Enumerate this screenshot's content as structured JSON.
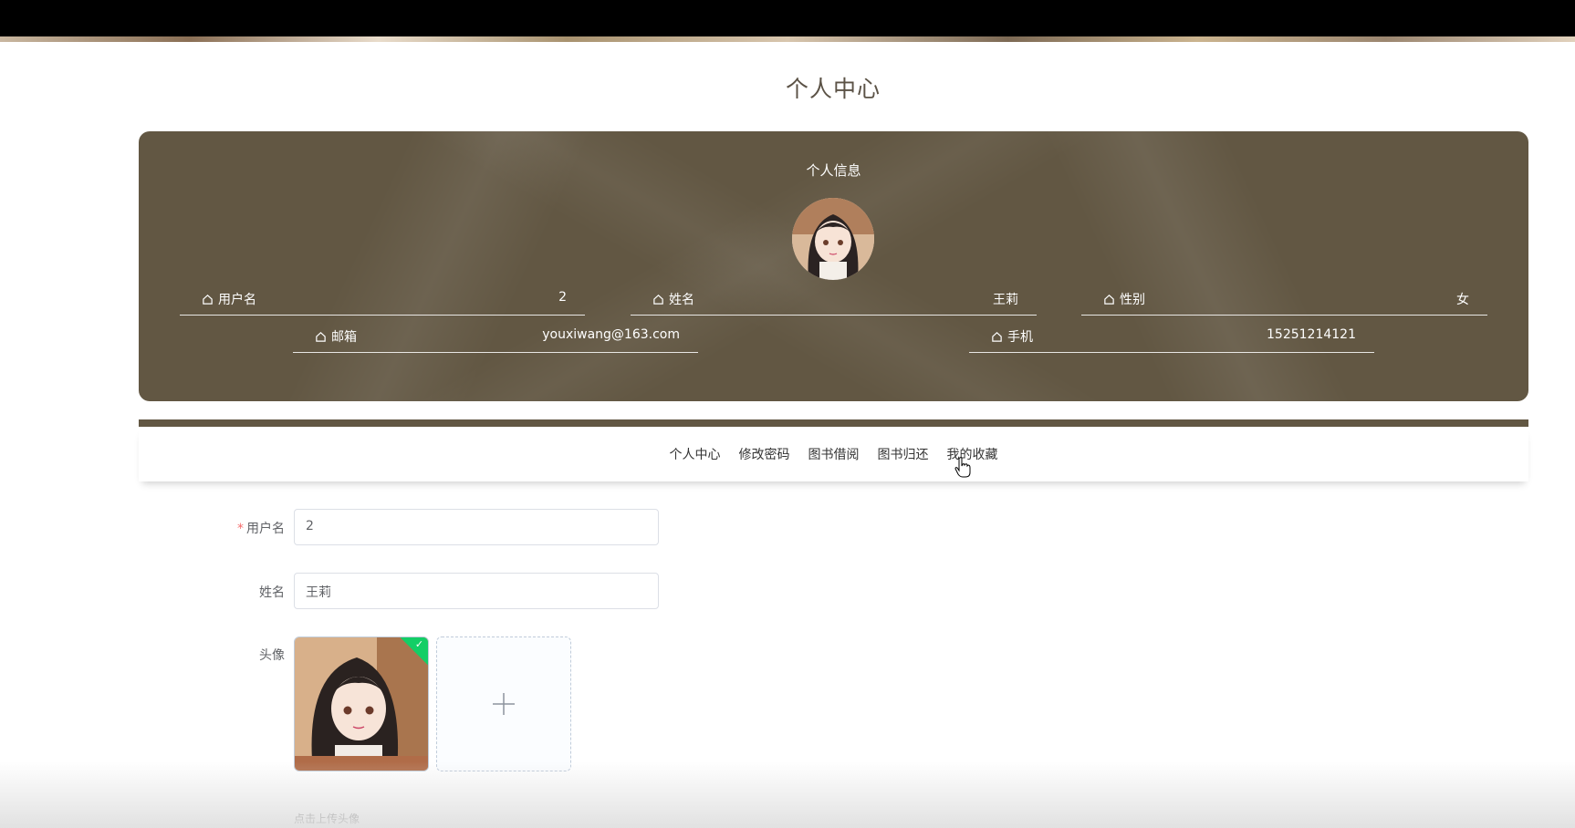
{
  "page": {
    "title": "个人中心"
  },
  "info": {
    "title": "个人信息",
    "fields": {
      "username": {
        "label": "用户名",
        "value": "2"
      },
      "name": {
        "label": "姓名",
        "value": "王莉"
      },
      "gender": {
        "label": "性别",
        "value": "女"
      },
      "email": {
        "label": "邮箱",
        "value": "youxiwang@163.com"
      },
      "phone": {
        "label": "手机",
        "value": "15251214121"
      }
    }
  },
  "tabs": [
    {
      "label": "个人中心"
    },
    {
      "label": "修改密码"
    },
    {
      "label": "图书借阅"
    },
    {
      "label": "图书归还"
    },
    {
      "label": "我的收藏"
    }
  ],
  "form": {
    "username": {
      "label": "用户名",
      "required_mark": "*",
      "value": "2"
    },
    "name": {
      "label": "姓名",
      "value": "王莉"
    },
    "avatar": {
      "label": "头像",
      "tip": "点击上传头像"
    }
  },
  "colors": {
    "panel": "#625743",
    "success": "#13ce66",
    "required": "#f56c6c"
  },
  "icons": {
    "field_icon": "home-icon",
    "upload": "plus-icon",
    "uploaded": "check-icon",
    "cursor": "hand-pointer-icon"
  }
}
